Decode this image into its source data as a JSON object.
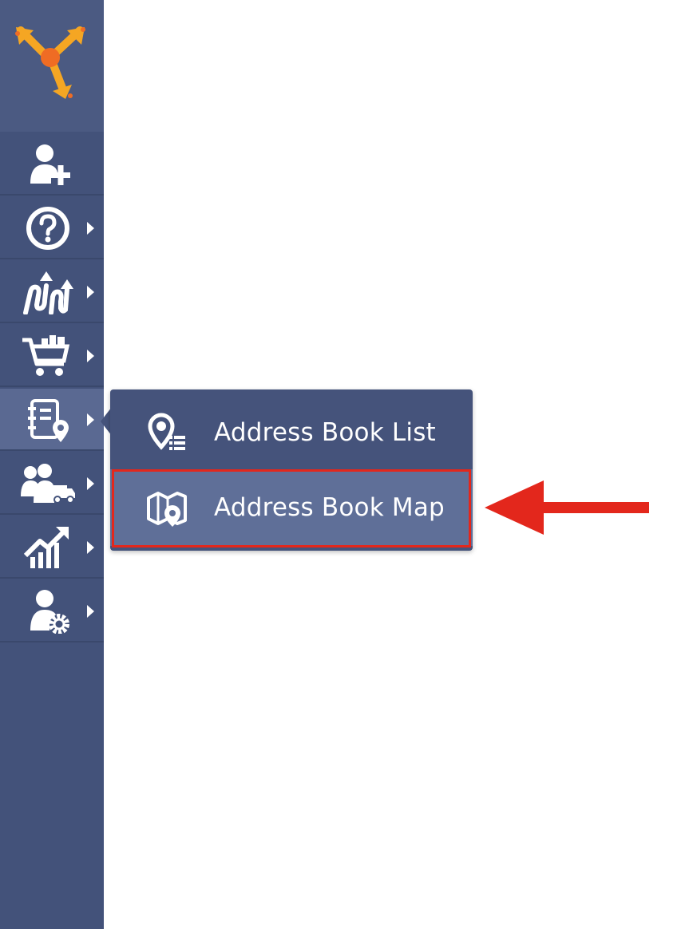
{
  "colors": {
    "sidebar_bg": "#43527a",
    "flyout_bg": "#45537b",
    "active_item_bg": "#5f6f98",
    "highlight_red": "#e3271c"
  },
  "sidebar": {
    "logo": "route4me-logo-icon",
    "items": [
      {
        "name": "add-user",
        "icon": "user-plus-icon",
        "has_submenu": false
      },
      {
        "name": "help",
        "icon": "question-circle-icon",
        "has_submenu": true
      },
      {
        "name": "routes",
        "icon": "routes-icon",
        "has_submenu": true
      },
      {
        "name": "orders",
        "icon": "shopping-cart-icon",
        "has_submenu": true
      },
      {
        "name": "address-book",
        "icon": "address-book-icon",
        "has_submenu": true,
        "active": true
      },
      {
        "name": "team",
        "icon": "team-vehicle-icon",
        "has_submenu": true
      },
      {
        "name": "analytics",
        "icon": "analytics-chart-icon",
        "has_submenu": true
      },
      {
        "name": "settings",
        "icon": "user-gear-icon",
        "has_submenu": true
      }
    ]
  },
  "flyout": {
    "items": [
      {
        "label": "Address Book List",
        "icon": "location-list-icon"
      },
      {
        "label": "Address Book Map",
        "icon": "map-location-icon",
        "highlighted": true
      }
    ]
  },
  "annotation": {
    "callout": "red-arrow-icon"
  }
}
